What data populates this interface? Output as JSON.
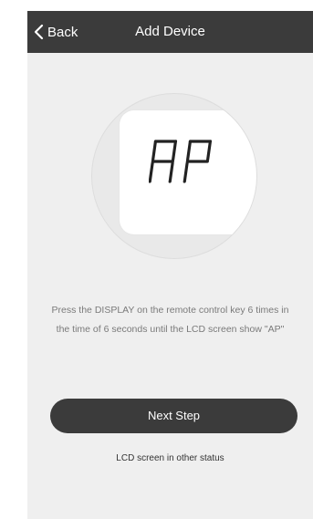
{
  "navbar": {
    "back_label": "Back",
    "title": "Add Device"
  },
  "illustration": {
    "lcd_text": "AP"
  },
  "instruction": {
    "line1": "Press the DISPLAY on the remote control key 6 times in",
    "line2": "the time of 6 seconds until the LCD screen show \"AP\""
  },
  "actions": {
    "next_step_label": "Next Step",
    "other_status_label": "LCD screen in other status"
  },
  "colors": {
    "navbar_bg": "#3b3b3b",
    "screen_bg": "#efefef",
    "button_bg": "#3b3b3b",
    "text_muted": "#7a7a7a"
  }
}
